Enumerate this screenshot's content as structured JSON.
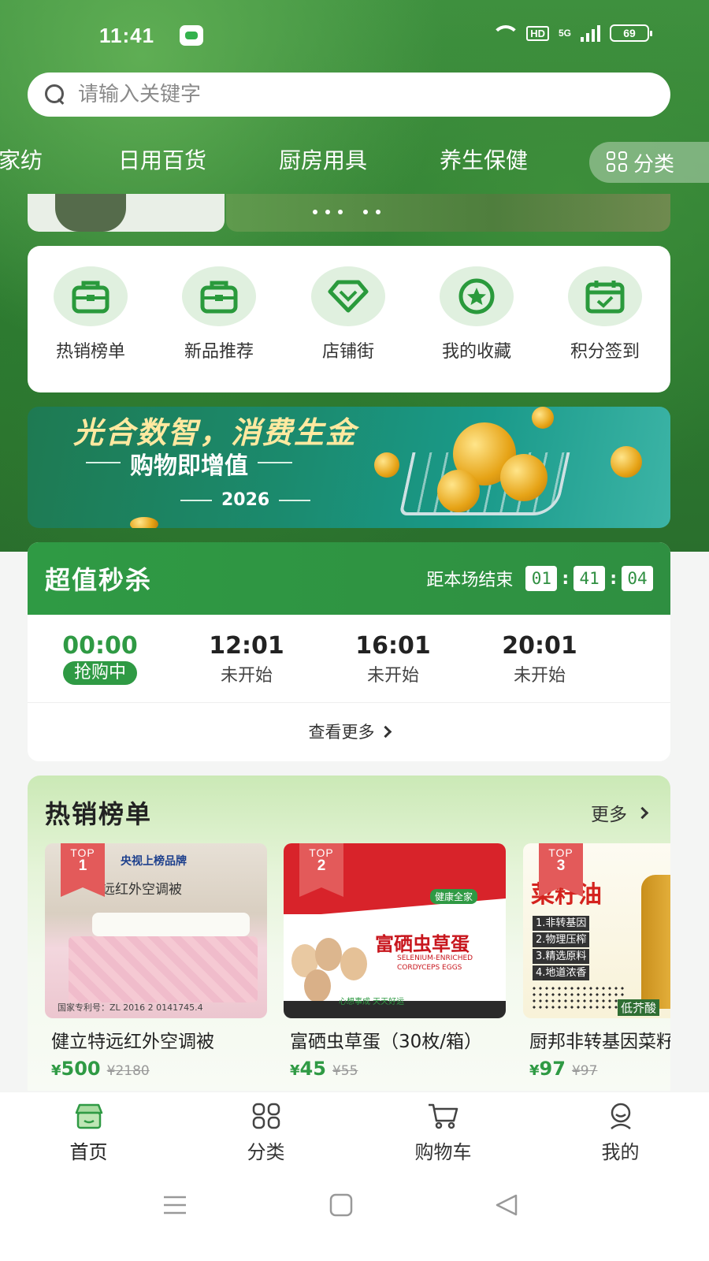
{
  "status_bar": {
    "time": "11:41",
    "hd": "HD",
    "network": "5G",
    "battery": "69"
  },
  "search": {
    "placeholder": "请输入关键字"
  },
  "category_tabs": [
    "居家纺",
    "日用百货",
    "厨房用具",
    "养生保健"
  ],
  "category_button": "分类",
  "quick_menu": [
    {
      "label": "热销榜单",
      "icon": "bag-icon"
    },
    {
      "label": "新品推荐",
      "icon": "bag-icon"
    },
    {
      "label": "店铺街",
      "icon": "gem-icon"
    },
    {
      "label": "我的收藏",
      "icon": "star-icon"
    },
    {
      "label": "积分签到",
      "icon": "calendar-check-icon"
    }
  ],
  "promo_banner": {
    "title": "光合数智，消费生金",
    "subtitle": "购物即增值",
    "year": "2026"
  },
  "flash_sale": {
    "title": "超值秒杀",
    "countdown_label": "距本场结束",
    "countdown": {
      "h": "01",
      "m": "41",
      "s": "04"
    },
    "slots": [
      {
        "time": "00:00",
        "status": "抢购中",
        "active": true
      },
      {
        "time": "12:01",
        "status": "未开始",
        "active": false
      },
      {
        "time": "16:01",
        "status": "未开始",
        "active": false
      },
      {
        "time": "20:01",
        "status": "未开始",
        "active": false
      }
    ],
    "see_more": "查看更多"
  },
  "hot_list": {
    "title": "热销榜单",
    "more": "更多",
    "products": [
      {
        "rank": "1",
        "top": "TOP",
        "name": "健立特远红外空调被",
        "price_symbol": "¥",
        "price": "500",
        "old_price": "¥2180",
        "img_text": "远红外空调被",
        "img_brand": "央视上榜品牌",
        "img_footer": "国家专利号：ZL 2016 2 0141745.4"
      },
      {
        "rank": "2",
        "top": "TOP",
        "name": "富硒虫草蛋（30枚/箱）",
        "price_symbol": "¥",
        "price": "45",
        "old_price": "¥55",
        "img_text": "富硒虫草蛋",
        "img_sub": "SELENIUM-ENRICHED CORDYCEPS EGGS",
        "img_tag": "健康全家",
        "img_footer": "心想事成 天天好运"
      },
      {
        "rank": "3",
        "top": "TOP",
        "name": "厨邦非转基因菜籽油",
        "price_symbol": "¥",
        "price": "97",
        "old_price": "¥97",
        "img_text": "菜籽油",
        "img_points": [
          "1.非转基因",
          "2.物理压榨",
          "3.精选原料",
          "4.地道浓香"
        ],
        "img_footer": "低芥酸"
      }
    ]
  },
  "bottom_nav": [
    {
      "label": "首页",
      "icon": "home-icon",
      "active": true
    },
    {
      "label": "分类",
      "icon": "grid-icon",
      "active": false
    },
    {
      "label": "购物车",
      "icon": "cart-icon",
      "active": false
    },
    {
      "label": "我的",
      "icon": "user-icon",
      "active": false
    }
  ],
  "colors": {
    "brand_green": "#2f9a44",
    "badge_red": "#e35a5a"
  }
}
